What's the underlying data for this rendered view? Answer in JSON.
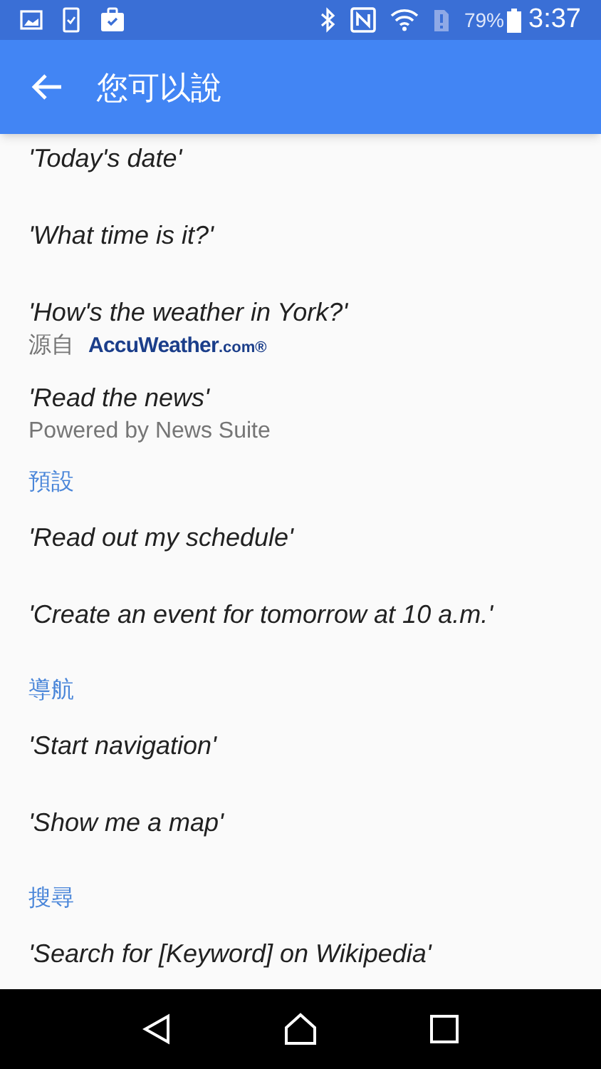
{
  "status_bar": {
    "battery": "79%",
    "time": "3:37"
  },
  "app_bar": {
    "title": "您可以說"
  },
  "items": [
    {
      "kind": "command",
      "text": "'Today's date'"
    },
    {
      "kind": "command",
      "text": "'What time is it?'"
    },
    {
      "kind": "command",
      "text": "'How's the weather in York?'",
      "source_label": "源自",
      "source_logo": "AccuWeather",
      "source_logo_suffix": ".com®"
    },
    {
      "kind": "command",
      "text": "'Read the news'",
      "subtitle": "Powered by News Suite"
    },
    {
      "kind": "header",
      "text": "預設"
    },
    {
      "kind": "command",
      "text": "'Read out my schedule'"
    },
    {
      "kind": "command",
      "text": "'Create an event for tomorrow at 10 a.m.'"
    },
    {
      "kind": "header",
      "text": "導航"
    },
    {
      "kind": "command",
      "text": "'Start navigation'"
    },
    {
      "kind": "command",
      "text": "'Show me a map'"
    },
    {
      "kind": "header",
      "text": "搜尋"
    },
    {
      "kind": "command",
      "text": "'Search for [Keyword] on Wikipedia'"
    }
  ]
}
